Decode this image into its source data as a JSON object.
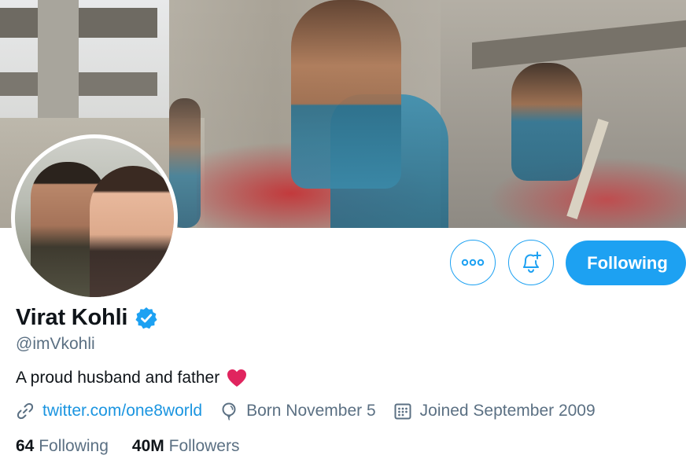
{
  "profile": {
    "name": "Virat Kohli",
    "handle": "@imVkohli",
    "bio": "A proud husband and father",
    "website": "twitter.com/one8world",
    "birthday": "Born November 5",
    "joined": "Joined September 2009"
  },
  "stats": {
    "following_count": "64",
    "following_label": "Following",
    "followers_count": "40M",
    "followers_label": "Followers"
  },
  "actions": {
    "follow_button": "Following",
    "more_icon": "more-icon",
    "notifications_icon": "bell-plus-icon"
  },
  "colors": {
    "accent": "#1da1f2",
    "link": "#1b95e0",
    "secondary_text": "#5b7083",
    "verified": "#1da1f2",
    "heart": "#e0245e"
  }
}
